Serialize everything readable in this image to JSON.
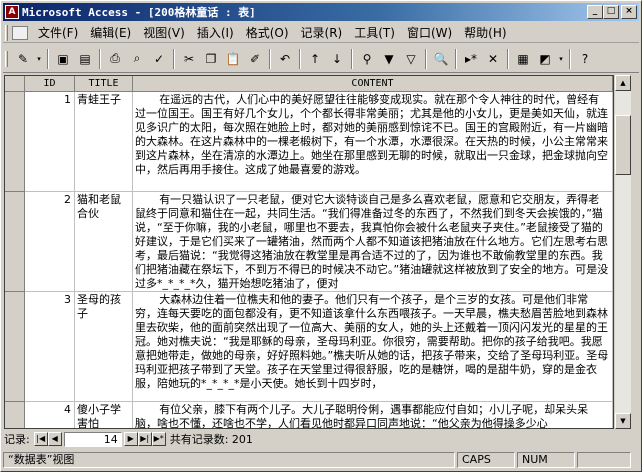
{
  "window": {
    "app_icon": "key-icon",
    "title": "Microsoft Access - [200格林童话 : 表]",
    "min_glyph": "_",
    "max_glyph": "□",
    "close_glyph": "×"
  },
  "menubar": {
    "items": [
      {
        "label": "文件(F)"
      },
      {
        "label": "编辑(E)"
      },
      {
        "label": "视图(V)"
      },
      {
        "label": "插入(I)"
      },
      {
        "label": "格式(O)"
      },
      {
        "label": "记录(R)"
      },
      {
        "label": "工具(T)"
      },
      {
        "label": "窗口(W)"
      },
      {
        "label": "帮助(H)"
      }
    ]
  },
  "toolbar": {
    "icons": [
      {
        "name": "design-view-icon",
        "glyph": "✎"
      },
      {
        "name": "dropdown-icon",
        "glyph": "▾",
        "small": true
      },
      {
        "sep": true
      },
      {
        "name": "save-icon",
        "glyph": "▣"
      },
      {
        "name": "new-record-icon",
        "glyph": "▤"
      },
      {
        "sep": true
      },
      {
        "name": "print-icon",
        "glyph": "⎙"
      },
      {
        "name": "print-preview-icon",
        "glyph": "⌕"
      },
      {
        "name": "spelling-icon",
        "glyph": "✓"
      },
      {
        "sep": true
      },
      {
        "name": "cut-icon",
        "glyph": "✂"
      },
      {
        "name": "copy-icon",
        "glyph": "❐"
      },
      {
        "name": "paste-icon",
        "glyph": "📋"
      },
      {
        "name": "format-painter-icon",
        "glyph": "✐"
      },
      {
        "sep": true
      },
      {
        "name": "undo-icon",
        "glyph": "↶"
      },
      {
        "sep": true
      },
      {
        "name": "sort-ascending-icon",
        "glyph": "↑"
      },
      {
        "name": "sort-descending-icon",
        "glyph": "↓"
      },
      {
        "sep": true
      },
      {
        "name": "filter-by-selection-icon",
        "glyph": "⚲"
      },
      {
        "name": "filter-by-form-icon",
        "glyph": "▼"
      },
      {
        "name": "apply-filter-icon",
        "glyph": "▽"
      },
      {
        "sep": true
      },
      {
        "name": "find-icon",
        "glyph": "🔍"
      },
      {
        "sep": true
      },
      {
        "name": "new-record-arrow-icon",
        "glyph": "▸*"
      },
      {
        "name": "delete-record-icon",
        "glyph": "✕"
      },
      {
        "sep": true
      },
      {
        "name": "database-window-icon",
        "glyph": "▦"
      },
      {
        "name": "new-object-icon",
        "glyph": "◩"
      },
      {
        "name": "dropdown-icon",
        "glyph": "▾",
        "small": true
      },
      {
        "sep": true
      },
      {
        "name": "help-icon",
        "glyph": "?"
      }
    ]
  },
  "table": {
    "columns": [
      "ID",
      "TITLE",
      "CONTENT"
    ],
    "rows": [
      {
        "id": "1",
        "title": "青蛙王子",
        "content": "在遥远的古代，人们心中的美好愿望往往能够变成现实。就在那个令人神往的时代，曾经有过一位国王。国王有好几个女儿，个个都长得非常美丽；尤其是他的小女儿，更是美如天仙，就连见多识广的太阳，每次照在她脸上时，都对她的美丽感到惊诧不已。国王的宫殿附近，有一片幽暗的大森林。在这片森林中的一棵老椴树下，有一个水潭，水潭很深。在天热的时候，小公主常常来到这片森林，坐在清凉的水潭边上。她坐在那里感到无聊的时候，就取出一只金球，把金球抛向空中，然后再用手接住。这成了她最喜爱的游戏。"
      },
      {
        "id": "2",
        "title": "猫和老鼠合伙",
        "content": "有一只猫认识了一只老鼠，便对它大谈特谈自己是多么喜欢老鼠，愿意和它交朋友，弄得老鼠终于同意和猫住在一起，共同生活。“我们得准备过冬的东西了，不然我们到冬天会挨饿的，”猫说，“至于你嘛，我的小老鼠，哪里也不要去，我真怕你会被什么老鼠夹子夹住。”老鼠接受了猫的好建议，于是它们买来了一罐猪油，然而两个人都不知道该把猪油放在什么地方。它们左思考右思考，最后猫说：“我觉得这猪油放在教堂里是再合适不过的了，因为谁也不敢偷教堂里的东西。我们把猪油藏在祭坛下，不到万不得已的时候决不动它。”猪油罐就这样被放到了安全的地方。可是没过多*_*_*_*久，猫开始想吃猪油了，便对"
      },
      {
        "id": "3",
        "title": "圣母的孩子",
        "content": "大森林边住着一位樵夫和他的妻子。他们只有一个孩子，是个三岁的女孩。可是他们非常穷，连每天要吃的面包都没有，更不知道该拿什么东西喂孩子。一天早晨，樵夫愁眉苦脸地到森林里去砍柴，他的面前突然出现了一位高大、美丽的女人，她的头上还戴着一顶闪闪发光的星星的王冠。她对樵夫说：“我是耶稣的母亲，圣母玛利亚。你很穷，需要帮助。把你的孩子给我吧。我愿意把她带走，做她的母亲，好好照料她。”樵夫听从她的话，把孩子带来，交给了圣母玛利亚。圣母玛利亚把孩子带到了天堂。孩子在天堂里过得很舒服，吃的是糖饼，喝的是甜牛奶，穿的是金衣服，陪她玩的*_*_*_*是小天使。她长到十四岁时，"
      },
      {
        "id": "4",
        "title": "傻小子学害怕",
        "content": "有位父亲，膝下有两个儿子。大儿子聪明伶俐，遇事都能应付自如；小儿子呢，却呆头呆脑，啥也不懂，还啥也不学，人们看见他时都异口同声地说：“他父亲为他得操多少心"
      }
    ]
  },
  "scrollbar": {
    "up": "▲",
    "down": "▼"
  },
  "navigation": {
    "label": "记录:",
    "first": "|◀",
    "prev": "◀",
    "current": "14",
    "next": "▶",
    "last": "▶|",
    "new": "▶*",
    "count_label": "共有记录数: 201"
  },
  "status": {
    "view": "“数据表”视图",
    "caps": "CAPS",
    "num": "NUM"
  }
}
